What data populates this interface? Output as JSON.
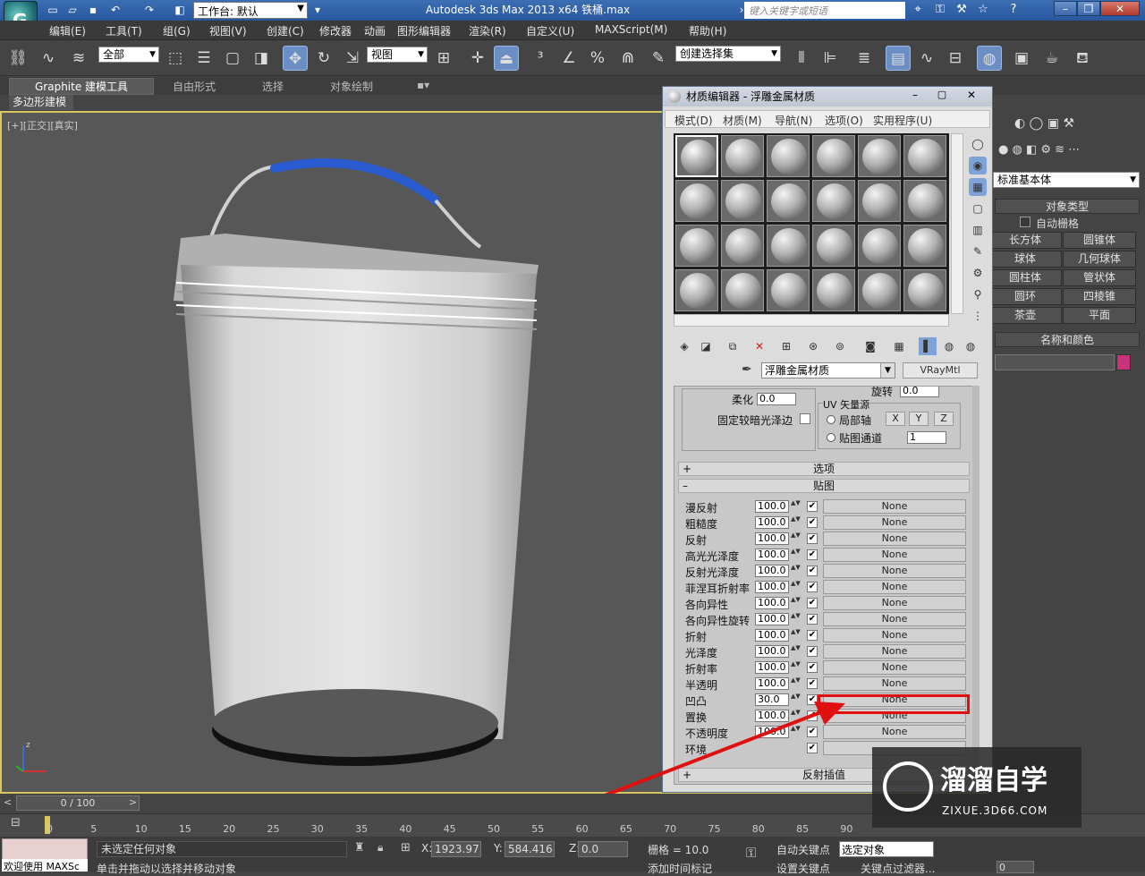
{
  "app": {
    "title": "Autodesk 3ds Max  2013 x64      铁桶.max",
    "workspace": "工作台: 默认",
    "help_search_placeholder": "键入关键字或短语"
  },
  "menubar": [
    "编辑(E)",
    "工具(T)",
    "组(G)",
    "视图(V)",
    "创建(C)",
    "修改器",
    "动画",
    "图形编辑器",
    "渲染(R)",
    "自定义(U)",
    "MAXScript(M)",
    "帮助(H)"
  ],
  "toolbar": {
    "selection_filter": "全部",
    "reference_coord": "视图",
    "named_selection": "创建选择集"
  },
  "ribbon": {
    "tabs": [
      "Graphite 建模工具",
      "自由形式",
      "选择",
      "对象绘制"
    ],
    "subtab": "多边形建模"
  },
  "viewport": {
    "label": "[+][正交][真实]"
  },
  "material_editor": {
    "title": "材质编辑器 - 浮雕金属材质",
    "menus": [
      "模式(D)",
      "材质(M)",
      "导航(N)",
      "选项(O)",
      "实用程序(U)"
    ],
    "material_name": "浮雕金属材质",
    "material_type": "VRayMtl",
    "soften_label": "柔化",
    "soften_value": "0.0",
    "rotate_label": "旋转",
    "rotate_value": "0.0",
    "fix_dark_label": "固定较暗光泽边",
    "uv_group_label": "UV 矢量源",
    "local_axis_label": "局部轴",
    "axis_x": "X",
    "axis_y": "Y",
    "axis_z": "Z",
    "map_channel_label": "贴图通道",
    "map_channel_value": "1",
    "rollout_options": "选项",
    "rollout_maps": "贴图",
    "rollout_reflect_interp": "反射插值",
    "maps": [
      {
        "label": "漫反射",
        "value": "100.0",
        "map": "None"
      },
      {
        "label": "粗糙度",
        "value": "100.0",
        "map": "None"
      },
      {
        "label": "反射",
        "value": "100.0",
        "map": "None"
      },
      {
        "label": "高光光泽度",
        "value": "100.0",
        "map": "None"
      },
      {
        "label": "反射光泽度",
        "value": "100.0",
        "map": "None"
      },
      {
        "label": "菲涅耳折射率",
        "value": "100.0",
        "map": "None"
      },
      {
        "label": "各向异性",
        "value": "100.0",
        "map": "None"
      },
      {
        "label": "各向异性旋转",
        "value": "100.0",
        "map": "None"
      },
      {
        "label": "折射",
        "value": "100.0",
        "map": "None"
      },
      {
        "label": "光泽度",
        "value": "100.0",
        "map": "None"
      },
      {
        "label": "折射率",
        "value": "100.0",
        "map": "None"
      },
      {
        "label": "半透明",
        "value": "100.0",
        "map": "None"
      },
      {
        "label": "凹凸",
        "value": "30.0",
        "map": "None"
      },
      {
        "label": "置换",
        "value": "100.0",
        "map": "None"
      },
      {
        "label": "不透明度",
        "value": "100.0",
        "map": "None"
      },
      {
        "label": "环境",
        "value": "",
        "map": ""
      }
    ]
  },
  "command_panel": {
    "category": "标准基本体",
    "object_type_header": "对象类型",
    "autogrid_label": "自动栅格",
    "buttons": [
      "长方体",
      "圆锥体",
      "球体",
      "几何球体",
      "圆柱体",
      "管状体",
      "圆环",
      "四棱锥",
      "茶壶",
      "平面"
    ],
    "name_color_header": "名称和颜色",
    "object_color": "#c8327a"
  },
  "timeline": {
    "slider": "0 / 100",
    "ticks": [
      "0",
      "5",
      "10",
      "15",
      "20",
      "25",
      "30",
      "35",
      "40",
      "45",
      "50",
      "55",
      "60",
      "65",
      "70",
      "75",
      "80",
      "85",
      "90"
    ]
  },
  "status": {
    "selection": "未选定任何对象",
    "prompt": "单击并拖动以选择并移动对象",
    "maxscript": "欢迎使用 MAXSc",
    "x_label": "X:",
    "x_value": "1923.97",
    "y_label": "Y:",
    "y_value": "584.416",
    "z_label": "Z:",
    "z_value": "0.0",
    "grid": "栅格 = 10.0",
    "auto_key": "自动关键点",
    "selected_obj": "选定对象",
    "set_key": "设置关键点",
    "key_filter": "关键点过滤器...",
    "add_time_tag": "添加时间标记",
    "frame": "0"
  },
  "watermark": {
    "brand": "溜溜自学",
    "url": "ZIXUE.3D66.COM"
  }
}
